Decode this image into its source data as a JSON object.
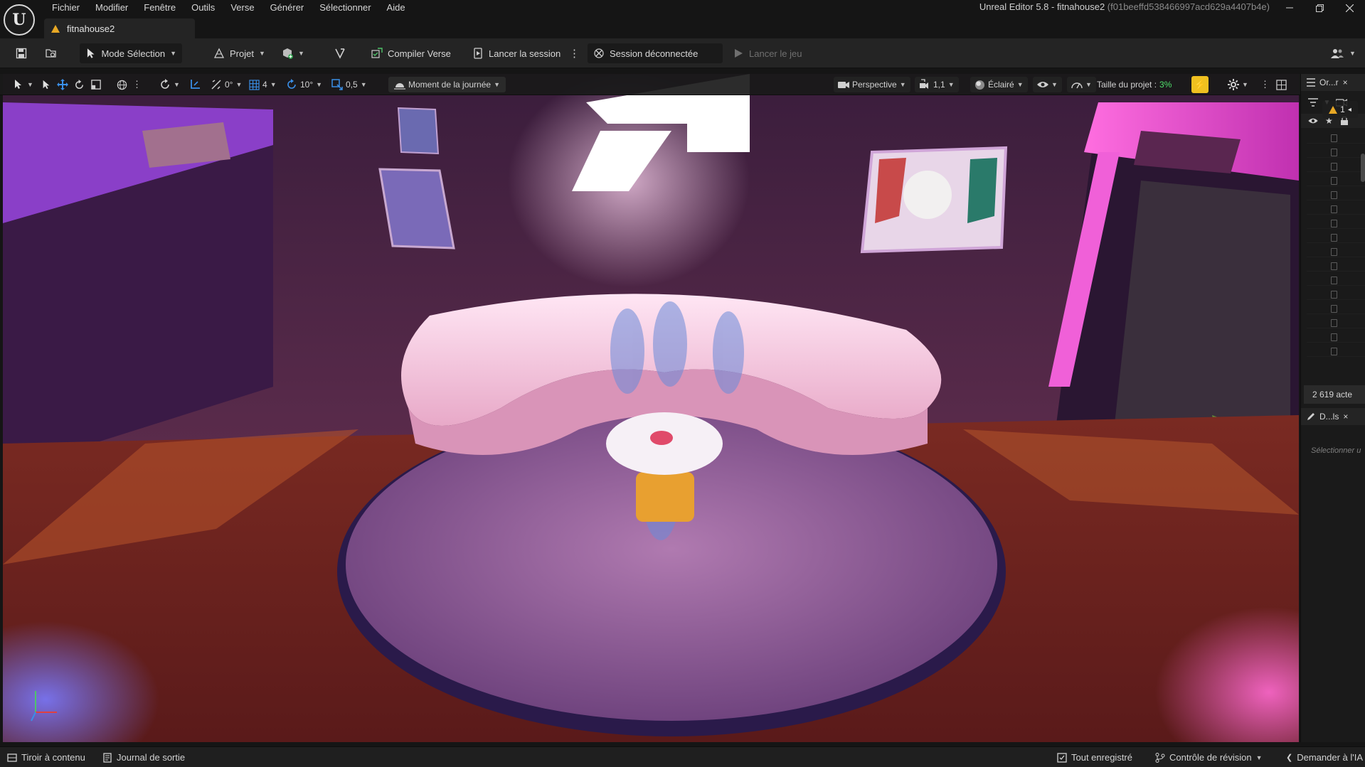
{
  "app": {
    "title": "Unreal Editor 5.8 - fitnahouse2",
    "title_hash": "(f01beeffd538466997acd629a4407b4e)"
  },
  "menu": [
    "Fichier",
    "Modifier",
    "Fenêtre",
    "Outils",
    "Verse",
    "Générer",
    "Sélectionner",
    "Aide"
  ],
  "document_tab": {
    "label": "fitnahouse2"
  },
  "toolbar": {
    "mode": "Mode Sélection",
    "project": "Projet",
    "compile": "Compiler Verse",
    "launch_session": "Lancer la session",
    "session_status": "Session déconnectée",
    "launch_game": "Lancer le jeu"
  },
  "viewport_toolbar": {
    "rotation_snap_value": "0°",
    "grid_value": "4",
    "angle_value": "10°",
    "scale_value": "0,5",
    "time_of_day": "Moment de la journée",
    "perspective": "Perspective",
    "speed": "1,1",
    "lit": "Éclairé",
    "project_size_label": "Taille du projet :",
    "project_size_value": "3%"
  },
  "viewport": {
    "warning_count": "1",
    "axis_z": "z",
    "axis_x": "x",
    "accent": "#e0349e"
  },
  "right_panel": {
    "outliner_tab": "Or...r",
    "actor_count": "2 619 acte",
    "details_tab": "D...ls",
    "details_hint": "Sélectionner u",
    "row_count": 16
  },
  "statusbar": {
    "content_drawer": "Tiroir à contenu",
    "output_log": "Journal de sortie",
    "saved": "Tout enregistré",
    "revision": "Contrôle de révision",
    "ai": "Demander à l'IA"
  }
}
